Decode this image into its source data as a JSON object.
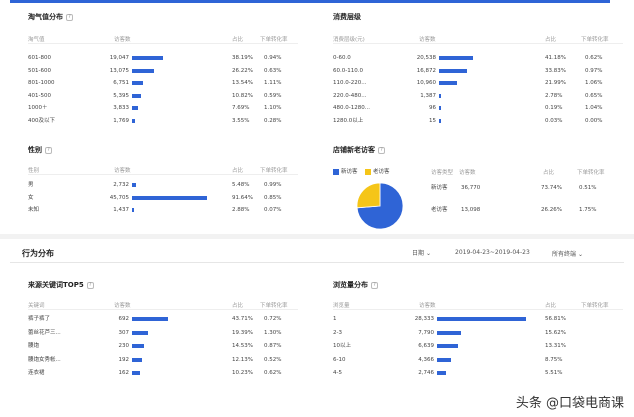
{
  "colors": {
    "accent": "#2f64d6",
    "new_visitor": "#2f64d6",
    "old_visitor": "#f5c518"
  },
  "naughty": {
    "title": "淘气值分布",
    "headers": [
      "淘气值",
      "访客数",
      "占比",
      "下单转化率"
    ],
    "rows": [
      {
        "label": "601-800",
        "count": "19,047",
        "pct": "38.19%",
        "conv": "0.94%",
        "ratio": 0.3819
      },
      {
        "label": "501-600",
        "count": "13,075",
        "pct": "26.22%",
        "conv": "0.63%",
        "ratio": 0.2622
      },
      {
        "label": "801-1000",
        "count": "6,751",
        "pct": "13.54%",
        "conv": "1.11%",
        "ratio": 0.1354
      },
      {
        "label": "401-500",
        "count": "5,395",
        "pct": "10.82%",
        "conv": "0.59%",
        "ratio": 0.1082
      },
      {
        "label": "1000＋",
        "count": "3,833",
        "pct": "7.69%",
        "conv": "1.10%",
        "ratio": 0.0769
      },
      {
        "label": "400及以下",
        "count": "1,769",
        "pct": "3.55%",
        "conv": "0.28%",
        "ratio": 0.0355
      }
    ]
  },
  "consume": {
    "title": "消费层级",
    "headers": [
      "消费层级(元)",
      "访客数",
      "占比",
      "下单转化率"
    ],
    "rows": [
      {
        "label": "0-60.0",
        "count": "20,538",
        "pct": "41.18%",
        "conv": "0.62%",
        "ratio": 0.4118
      },
      {
        "label": "60.0-110.0",
        "count": "16,872",
        "pct": "33.83%",
        "conv": "0.97%",
        "ratio": 0.3383
      },
      {
        "label": "110.0-220...",
        "count": "10,960",
        "pct": "21.99%",
        "conv": "1.06%",
        "ratio": 0.2199
      },
      {
        "label": "220.0-480...",
        "count": "1,387",
        "pct": "2.78%",
        "conv": "0.65%",
        "ratio": 0.0278
      },
      {
        "label": "480.0-1280...",
        "count": "96",
        "pct": "0.19%",
        "conv": "1.04%",
        "ratio": 0.0019
      },
      {
        "label": "1280.0以上",
        "count": "15",
        "pct": "0.03%",
        "conv": "0.00%",
        "ratio": 0.0003
      }
    ]
  },
  "gender": {
    "title": "性别",
    "headers": [
      "性别",
      "访客数",
      "占比",
      "下单转化率"
    ],
    "rows": [
      {
        "label": "男",
        "count": "2,732",
        "pct": "5.48%",
        "conv": "0.99%",
        "ratio": 0.0548
      },
      {
        "label": "女",
        "count": "45,705",
        "pct": "91.64%",
        "conv": "0.85%",
        "ratio": 0.9164
      },
      {
        "label": "未知",
        "count": "1,437",
        "pct": "2.88%",
        "conv": "0.07%",
        "ratio": 0.0288
      }
    ]
  },
  "store": {
    "title": "店铺新老访客",
    "legend_new": "新访客",
    "legend_old": "老访客",
    "headers": [
      "访客类型",
      "访客数",
      "占比",
      "下单转化率"
    ],
    "rows": [
      {
        "label": "新访客",
        "count": "36,770",
        "pct": "73.74%",
        "conv": "0.51%"
      },
      {
        "label": "老访客",
        "count": "13,098",
        "pct": "26.26%",
        "conv": "1.75%"
      }
    ]
  },
  "behavior": {
    "title": "行为分布",
    "period_label": "日期",
    "date_range": "2019-04-23~2019-04-23",
    "terminal": "所有终端"
  },
  "keywords": {
    "title": "来源关键词TOP5",
    "headers": [
      "关键词",
      "访客数",
      "占比",
      "下单转化率"
    ],
    "rows": [
      {
        "label": "裤子裤了",
        "count": "692",
        "pct": "43.71%",
        "conv": "0.72%",
        "ratio": 0.4371
      },
      {
        "label": "蕾丝花芦三...",
        "count": "307",
        "pct": "19.39%",
        "conv": "1.30%",
        "ratio": 0.1939
      },
      {
        "label": "腰炮",
        "count": "230",
        "pct": "14.53%",
        "conv": "0.87%",
        "ratio": 0.1453
      },
      {
        "label": "腰炮女秀帐...",
        "count": "192",
        "pct": "12.13%",
        "conv": "0.52%",
        "ratio": 0.1213
      },
      {
        "label": "连衣裙",
        "count": "162",
        "pct": "10.23%",
        "conv": "0.62%",
        "ratio": 0.1023
      }
    ]
  },
  "depth": {
    "title": "浏览量分布",
    "headers": [
      "浏览量",
      "访客数",
      "占比",
      "下单转化率"
    ],
    "rows": [
      {
        "label": "1",
        "count": "28,333",
        "pct": "56.81%",
        "conv": "",
        "ratio": 0.5681
      },
      {
        "label": "2-3",
        "count": "7,790",
        "pct": "15.62%",
        "conv": "",
        "ratio": 0.1562
      },
      {
        "label": "10以上",
        "count": "6,639",
        "pct": "13.31%",
        "conv": "",
        "ratio": 0.1331
      },
      {
        "label": "6-10",
        "count": "4,366",
        "pct": "8.75%",
        "conv": "",
        "ratio": 0.0875
      },
      {
        "label": "4-5",
        "count": "2,746",
        "pct": "5.51%",
        "conv": "",
        "ratio": 0.0551
      }
    ]
  },
  "watermark": "头条 @口袋电商课"
}
